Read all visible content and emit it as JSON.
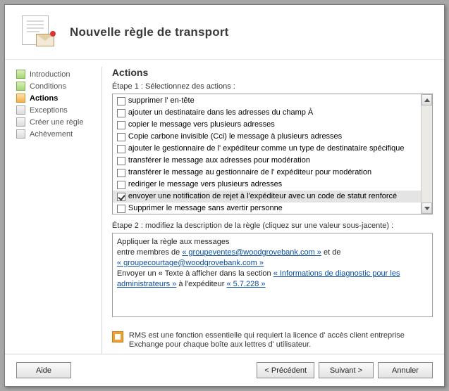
{
  "header": {
    "title": "Nouvelle règle de transport"
  },
  "sidebar": {
    "items": [
      {
        "label": "Introduction",
        "state": "done"
      },
      {
        "label": "Conditions",
        "state": "done"
      },
      {
        "label": "Actions",
        "state": "active"
      },
      {
        "label": "Exceptions",
        "state": "pending"
      },
      {
        "label": "Créer une règle",
        "state": "pending"
      },
      {
        "label": "Achèvement",
        "state": "pending"
      }
    ]
  },
  "content": {
    "section_title": "Actions",
    "step1_label": "Étape 1 : Sélectionnez des actions :",
    "actions": [
      {
        "label": "supprimer l' en-tête",
        "checked": false
      },
      {
        "label": "ajouter un destinataire dans les adresses du champ À",
        "checked": false
      },
      {
        "label": "copier le message vers plusieurs adresses",
        "checked": false
      },
      {
        "label": "Copie carbone invisible (Cci) le message à plusieurs adresses",
        "checked": false
      },
      {
        "label": "ajouter le gestionnaire de l' expéditeur comme un type de destinataire spécifique",
        "checked": false
      },
      {
        "label": "transférer le message aux adresses pour modération",
        "checked": false
      },
      {
        "label": "transférer le message au gestionnaire de l' expéditeur pour modération",
        "checked": false
      },
      {
        "label": "rediriger le message vers plusieurs adresses",
        "checked": false
      },
      {
        "label": "envoyer une notification de rejet à l'expéditeur avec un code de statut renforcé",
        "checked": true,
        "selected": true
      },
      {
        "label": "Supprimer le message sans avertir personne",
        "checked": false
      }
    ],
    "step2_label": "Étape 2 : modifiez la description de la règle (cliquez sur une valeur sous-jacente) :",
    "desc": {
      "line1": "Appliquer la règle aux messages",
      "line2_pre": "entre membres de ",
      "line2_link1": "« groupeventes@woodgrovebank.com »",
      "line2_mid": " et de ",
      "line2_link2": "« groupecourtage@woodgrovebank.com »",
      "line3_pre": "Envoyer un « Texte à afficher dans la section ",
      "line3_link1": "« Informations de diagnostic pour les administrateurs »",
      "line3_mid": " à l'expéditeur ",
      "line3_link2": "« 5.7.228 »"
    },
    "rms_text": "RMS est une fonction essentielle qui requiert la licence d' accès client entreprise Exchange pour chaque boîte aux lettres d' utilisateur."
  },
  "footer": {
    "help": "Aide",
    "back": "< Précédent",
    "next": "Suivant >",
    "cancel": "Annuler"
  }
}
